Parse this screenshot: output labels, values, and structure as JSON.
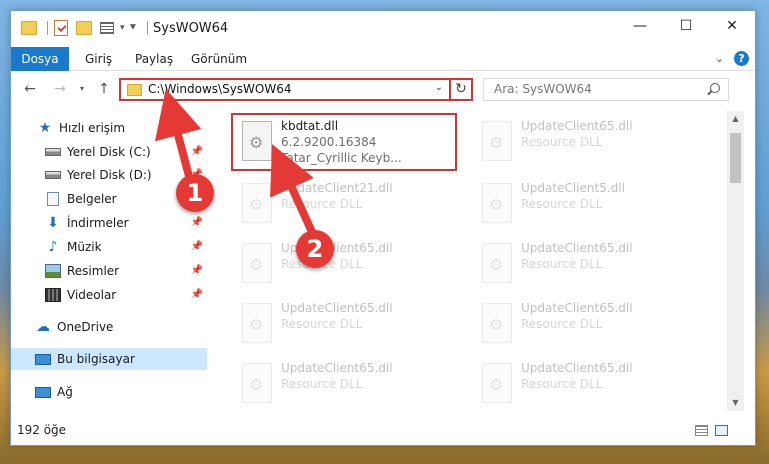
{
  "window": {
    "title": "SysWOW64",
    "controls": {
      "minimize": "—",
      "maximize": "☐",
      "close": "✕"
    }
  },
  "ribbon": {
    "tabs": [
      "Dosya",
      "Giriş",
      "Paylaş",
      "Görünüm"
    ],
    "expand_icon": "chevron-down-icon",
    "help": "?"
  },
  "address": {
    "path": "C:\\Windows\\SysWOW64",
    "search_placeholder": "Ara: SysWOW64"
  },
  "sidebar": {
    "items": [
      {
        "label": "Hızlı erişim",
        "icon": "star-icon",
        "pinned": false
      },
      {
        "label": "Yerel Disk (C:)",
        "icon": "disk-icon",
        "pinned": true
      },
      {
        "label": "Yerel Disk (D:)",
        "icon": "disk-icon",
        "pinned": true
      },
      {
        "label": "Belgeler",
        "icon": "documents-icon",
        "pinned": true
      },
      {
        "label": "İndirmeler",
        "icon": "download-icon",
        "pinned": true
      },
      {
        "label": "Müzik",
        "icon": "music-icon",
        "pinned": true
      },
      {
        "label": "Resimler",
        "icon": "pictures-icon",
        "pinned": true
      },
      {
        "label": "Videolar",
        "icon": "video-icon",
        "pinned": true
      },
      {
        "label": "OneDrive",
        "icon": "cloud-icon",
        "pinned": false
      },
      {
        "label": "Bu bilgisayar",
        "icon": "computer-icon",
        "pinned": false,
        "selected": true
      },
      {
        "label": "Ağ",
        "icon": "network-icon",
        "pinned": false
      }
    ]
  },
  "files": [
    {
      "name": "kbdtat.dll",
      "version": "6.2.9200.16384",
      "description": "Tatar_Cyrillic Keyb...",
      "highlighted": true
    },
    {
      "name": "UpdateClient65.dll",
      "type": "Resource DLL"
    },
    {
      "name": "UpdateClient21.dll",
      "type": "Resource DLL"
    },
    {
      "name": "UpdateClient5.dll",
      "type": "Resource DLL"
    },
    {
      "name": "UpdateClient65.dll",
      "type": "Resource DLL"
    },
    {
      "name": "UpdateClient65.dll",
      "type": "Resource DLL"
    },
    {
      "name": "UpdateClient65.dll",
      "type": "Resource DLL"
    },
    {
      "name": "UpdateClient65.dll",
      "type": "Resource DLL"
    },
    {
      "name": "UpdateClient65.dll",
      "type": "Resource DLL"
    },
    {
      "name": "UpdateClient65.dll",
      "type": "Resource DLL"
    }
  ],
  "status": {
    "item_count": "192 öğe"
  },
  "annotations": {
    "step1": "1",
    "step2": "2"
  },
  "colors": {
    "accent": "#1979ca",
    "highlight": "#d93030",
    "badge": "#e53935",
    "selected": "#cce8ff"
  }
}
